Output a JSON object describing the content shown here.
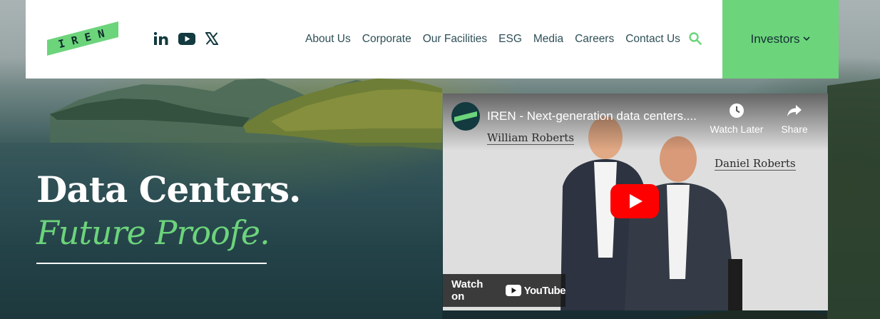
{
  "header": {
    "logo_text": "IREN",
    "social": [
      {
        "name": "linkedin-icon",
        "label": "in"
      },
      {
        "name": "youtube-icon",
        "label": ""
      },
      {
        "name": "x-icon",
        "label": "𝕏"
      }
    ],
    "nav": [
      "About Us",
      "Corporate",
      "Our Facilities",
      "ESG",
      "Media",
      "Careers",
      "Contact Us"
    ],
    "search_icon": "search-icon",
    "investors_label": "Investors",
    "investors_icon": "chevron-down-icon"
  },
  "hero": {
    "headline": "Data Centers.",
    "tagline": "Future Proofe."
  },
  "video": {
    "channel_avatar_text": "IREN",
    "title": "IREN - Next-generation data centers....",
    "watch_later_label": "Watch Later",
    "share_label": "Share",
    "person_left": "William Roberts",
    "person_right": "Daniel Roberts",
    "watch_on_label": "Watch on",
    "youtube_wordmark": "YouTube"
  },
  "colors": {
    "accent_green": "#6cd47b",
    "nav_text": "#2e4f57",
    "youtube_red": "#ff0000"
  }
}
